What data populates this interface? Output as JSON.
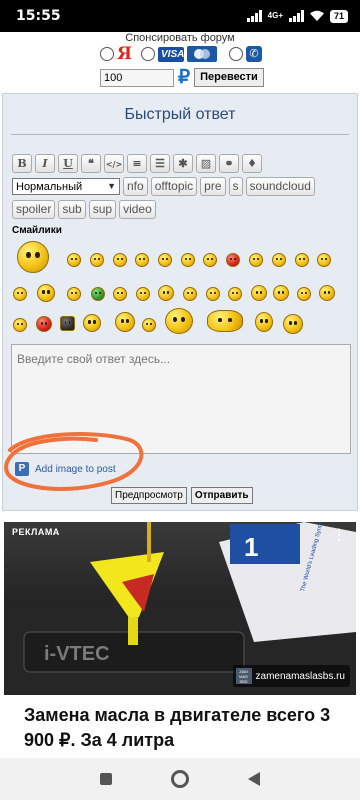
{
  "status_bar": {
    "time": "15:55",
    "network": "4G+",
    "battery": "71"
  },
  "sponsor": {
    "title": "Спонсировать форум",
    "options": [
      {
        "name": "yandex",
        "label": "Я"
      },
      {
        "name": "visa",
        "label": "VISA"
      },
      {
        "name": "mastercard",
        "label": ""
      },
      {
        "name": "phone",
        "label": ""
      }
    ],
    "amount": "100",
    "currency_symbol": "₽",
    "transfer_button": "Перевести"
  },
  "reply": {
    "title": "Быстрый ответ",
    "format_buttons": [
      {
        "name": "bold",
        "glyph": "B"
      },
      {
        "name": "italic",
        "glyph": "I"
      },
      {
        "name": "underline",
        "glyph": "U"
      },
      {
        "name": "quote",
        "glyph": "❝"
      },
      {
        "name": "code",
        "glyph": "</>"
      },
      {
        "name": "list",
        "glyph": "≡"
      },
      {
        "name": "ordered-list",
        "glyph": "☰"
      },
      {
        "name": "spoiler-star",
        "glyph": "✱"
      },
      {
        "name": "image",
        "glyph": "▨"
      },
      {
        "name": "link",
        "glyph": "⚭"
      },
      {
        "name": "color",
        "glyph": "♦"
      }
    ],
    "font_size": "Нормальный",
    "tag_buttons_row1": [
      "nfo",
      "offtopic",
      "pre",
      "s",
      "soundcloud"
    ],
    "tag_buttons_row2": [
      "spoiler",
      "sub",
      "sup",
      "video"
    ],
    "smileys_label": "Смайлики",
    "placeholder": "Введите свой ответ здесь...",
    "add_image": "Add image to post",
    "preview_button": "Предпросмотр",
    "send_button": "Отправить"
  },
  "ad": {
    "label": "РЕКЛАМА",
    "domain": "zamenamaslasbs.ru",
    "headline": "Замена масла в двигателе всего 3 900 ₽. За 4 литра",
    "engine_text": "i-VTEC",
    "bottle_text": "The World's Leading Synthetic Motor Oil"
  },
  "colors": {
    "accent": "#2a4a7a",
    "annotation": "#f2713a",
    "panel": "#e7ecf2"
  }
}
